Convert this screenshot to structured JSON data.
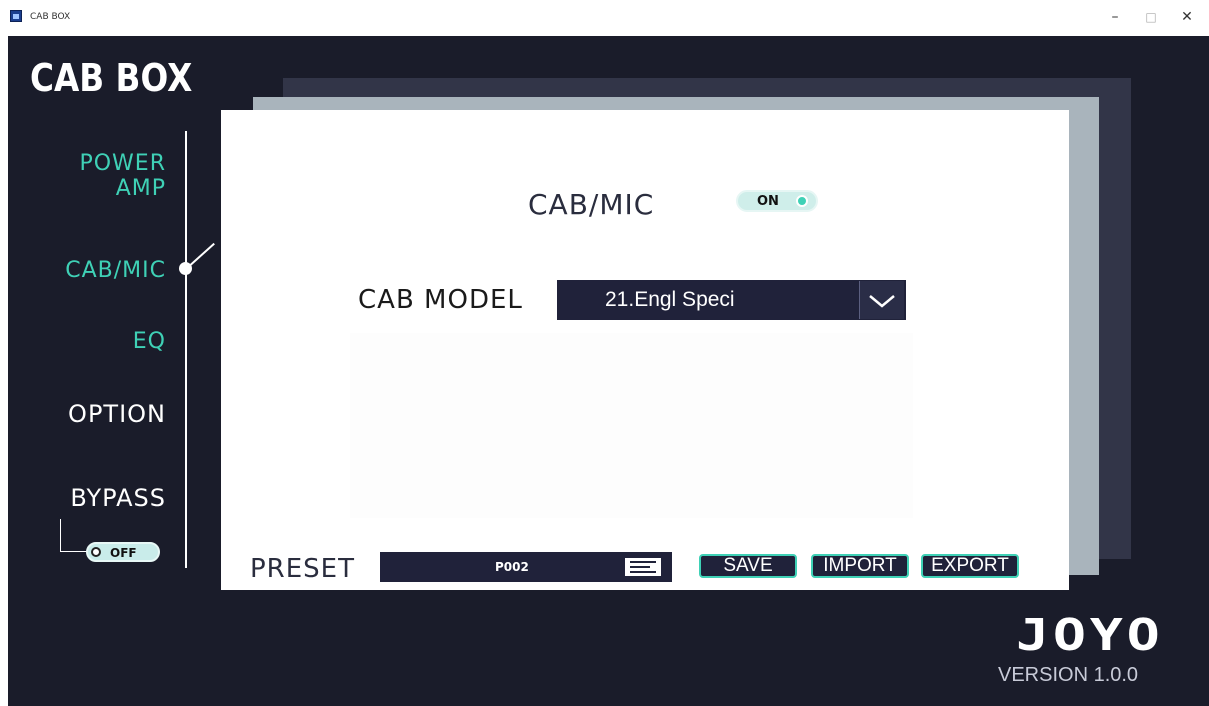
{
  "window": {
    "title": "CAB BOX",
    "min_glyph": "–",
    "max_glyph": "□",
    "close_glyph": "✕"
  },
  "app": {
    "brand": "CAB BOX"
  },
  "nav": {
    "items": [
      {
        "label": "POWER",
        "label2": "AMP"
      },
      {
        "label": "CAB/MIC"
      },
      {
        "label": "EQ"
      },
      {
        "label": "OPTION"
      },
      {
        "label": "BYPASS"
      }
    ],
    "bypass_toggle": "OFF"
  },
  "panel": {
    "cab_mic_label": "CAB/MIC",
    "cab_mic_toggle": "ON",
    "cab_model_label": "CAB MODEL",
    "cab_model_value": "21.Engl Speci"
  },
  "preset": {
    "label": "PRESET",
    "value": "P002",
    "save": "SAVE",
    "import": "IMPORT",
    "export": "EXPORT"
  },
  "footer": {
    "logo": "JOYO",
    "version": "VERSION 1.0.0"
  },
  "colors": {
    "teal": "#3fd1b6",
    "dark": "#1a1c2a",
    "panel": "#ffffff"
  }
}
